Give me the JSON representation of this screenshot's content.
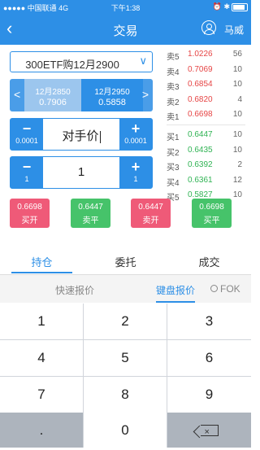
{
  "status": {
    "carrier": "●●●●● 中国联通  4G",
    "time": "下午1:38",
    "right": "⏰ ✱"
  },
  "nav": {
    "back_icon": "back-chevron-icon",
    "title": "交易",
    "user_icon": "user-icon",
    "user_name": "马威"
  },
  "contract_selector": {
    "value": "300ETF购12月2900",
    "icon": "chevron-down-icon"
  },
  "contract_switch": {
    "prev_name": "12月2850",
    "prev_price": "0.7906",
    "cur_name": "12月2950",
    "cur_price": "0.5858"
  },
  "price_stepper": {
    "minus": "−",
    "plus": "+",
    "step": "0.0001",
    "value": "对手价"
  },
  "qty_stepper": {
    "minus": "−",
    "plus": "+",
    "step": "1",
    "value": "1"
  },
  "orderbook": {
    "asks": [
      {
        "label": "卖5",
        "price": "1.0226",
        "qty": "56"
      },
      {
        "label": "卖4",
        "price": "0.7069",
        "qty": "10"
      },
      {
        "label": "卖3",
        "price": "0.6854",
        "qty": "10"
      },
      {
        "label": "卖2",
        "price": "0.6820",
        "qty": "4"
      },
      {
        "label": "卖1",
        "price": "0.6698",
        "qty": "10"
      }
    ],
    "bids": [
      {
        "label": "买1",
        "price": "0.6447",
        "qty": "10"
      },
      {
        "label": "买2",
        "price": "0.6435",
        "qty": "10"
      },
      {
        "label": "买3",
        "price": "0.6392",
        "qty": "2"
      },
      {
        "label": "买4",
        "price": "0.6361",
        "qty": "12"
      },
      {
        "label": "买5",
        "price": "0.5827",
        "qty": "10"
      }
    ]
  },
  "trade_buttons": [
    {
      "price": "0.6698",
      "action": "买开",
      "color": "#ef5a78"
    },
    {
      "price": "0.6447",
      "action": "卖平",
      "color": "#46c36a"
    },
    {
      "price": "0.6447",
      "action": "卖开",
      "color": "#ef5a78"
    },
    {
      "price": "0.6698",
      "action": "买平",
      "color": "#46c36a"
    }
  ],
  "tabs": [
    "持仓",
    "委托",
    "成交"
  ],
  "quote_modes": {
    "fast": "快速报价",
    "keyboard": "键盘报价",
    "fok": "FOK"
  },
  "keypad": [
    "1",
    "2",
    "3",
    "4",
    "5",
    "6",
    "7",
    "8",
    "9",
    ".",
    "0"
  ],
  "colors": {
    "accent": "#2d8fe6",
    "up": "#e64545",
    "down": "#2fb353"
  }
}
